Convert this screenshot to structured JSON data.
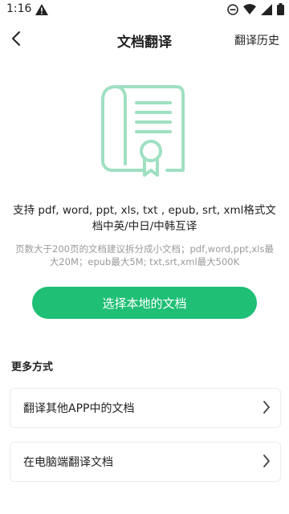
{
  "status_bar": {
    "time": "1:16"
  },
  "header": {
    "title": "文档翻译",
    "history_label": "翻译历史"
  },
  "support_text": "支持 pdf, word, ppt, xls, txt , epub, srt, xml格式文档中英/中日/中韩互译",
  "note_text": "页数大于200页的文档建议拆分成小文档；pdf,word,ppt,xls最大20M；epub最大5M; txt,srt,xml最大500K",
  "primary_button_label": "选择本地的文档",
  "more": {
    "title": "更多方式",
    "options": [
      {
        "label": "翻译其他APP中的文档"
      },
      {
        "label": "在电脑端翻译文档"
      }
    ]
  },
  "colors": {
    "accent": "#1fbf75",
    "illustration": "#9fe0c1"
  }
}
